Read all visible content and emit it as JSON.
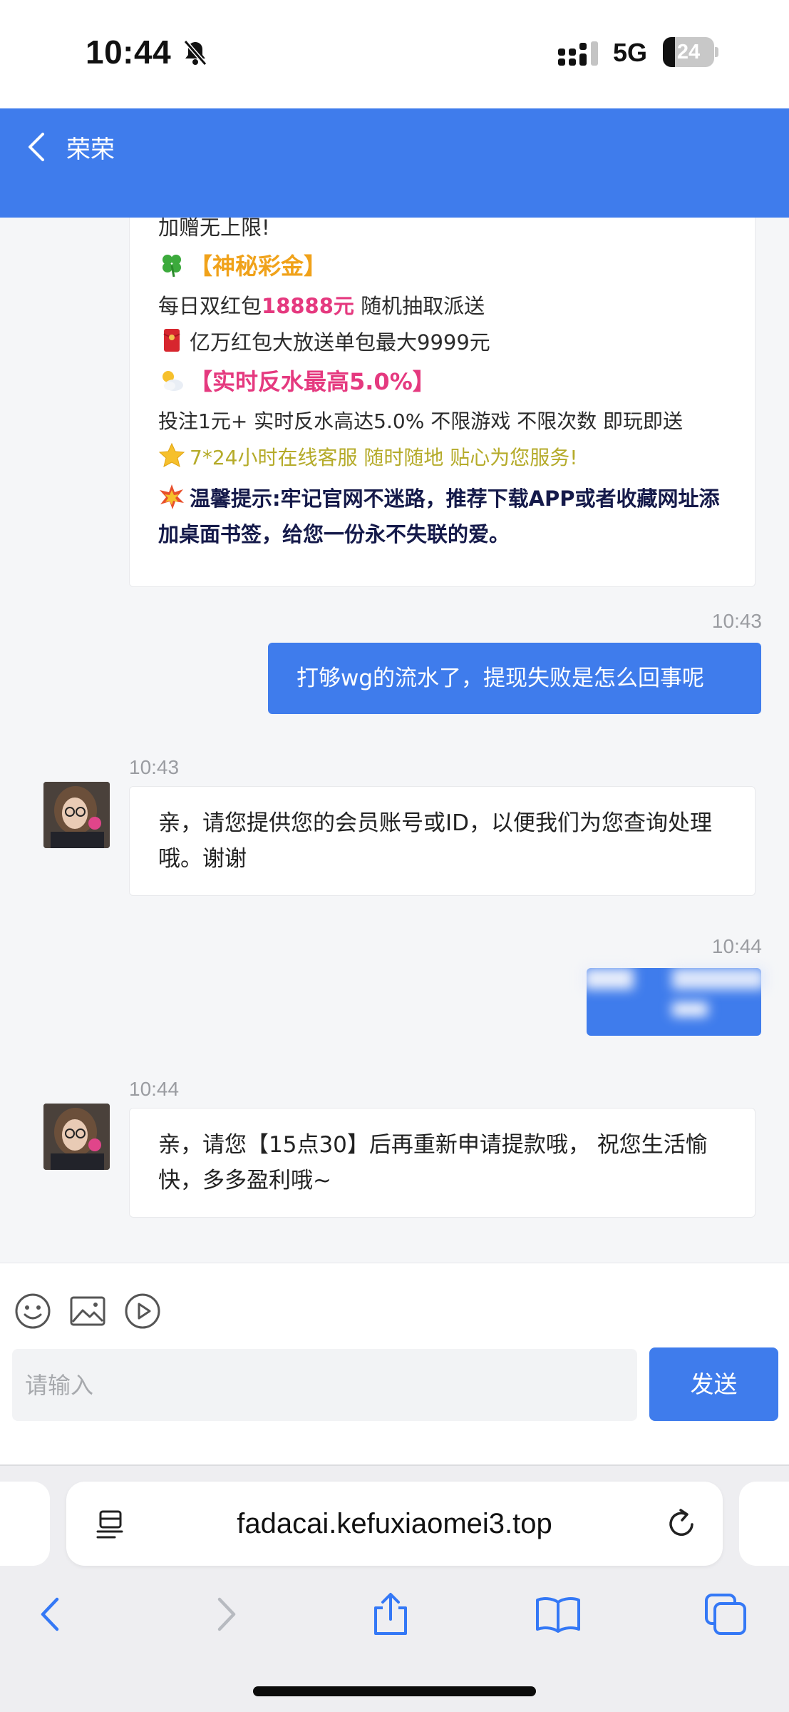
{
  "status_bar": {
    "time": "10:44",
    "network": "5G",
    "battery": "24",
    "battery_level": 0.24
  },
  "header": {
    "title": "荣荣"
  },
  "promo": {
    "line1": "加赠无上限!",
    "line2": "【神秘彩金】",
    "line3_prefix": "每日双红包",
    "line3_highlight": "18888元",
    "line3_suffix": " 随机抽取派送",
    "line4": "亿万红包大放送单包最大9999元",
    "line5": "【实时反水最高5.0%】",
    "line6": "投注1元+ 实时反水高达5.0% 不限游戏 不限次数 即玩即送",
    "line7": "7*24小时在线客服 随时随地 贴心为您服务!",
    "line8": "温馨提示:牢记官网不迷路，推荐下载APP或者收藏网址添加桌面书签，给您一份永不失联的爱。"
  },
  "messages": [
    {
      "time": "10:43",
      "text": "打够wg的流水了，提现失败是怎么回事呢"
    },
    {
      "time": "10:43",
      "text": "亲，请您提供您的会员账号或ID，以便我们为您查询处理哦。谢谢"
    },
    {
      "time": "10:44",
      "text": ""
    },
    {
      "time": "10:44",
      "text": "亲，请您【15点30】后再重新申请提款哦， 祝您生活愉快，多多盈利哦~"
    }
  ],
  "composer": {
    "placeholder": "请输入",
    "send_label": "发送"
  },
  "browser": {
    "url": "fadacai.kefuxiaomei3.top"
  },
  "colors": {
    "accent": "#3f7cec",
    "highlight_pink": "#e5397f",
    "gold": "#f0a21a"
  }
}
